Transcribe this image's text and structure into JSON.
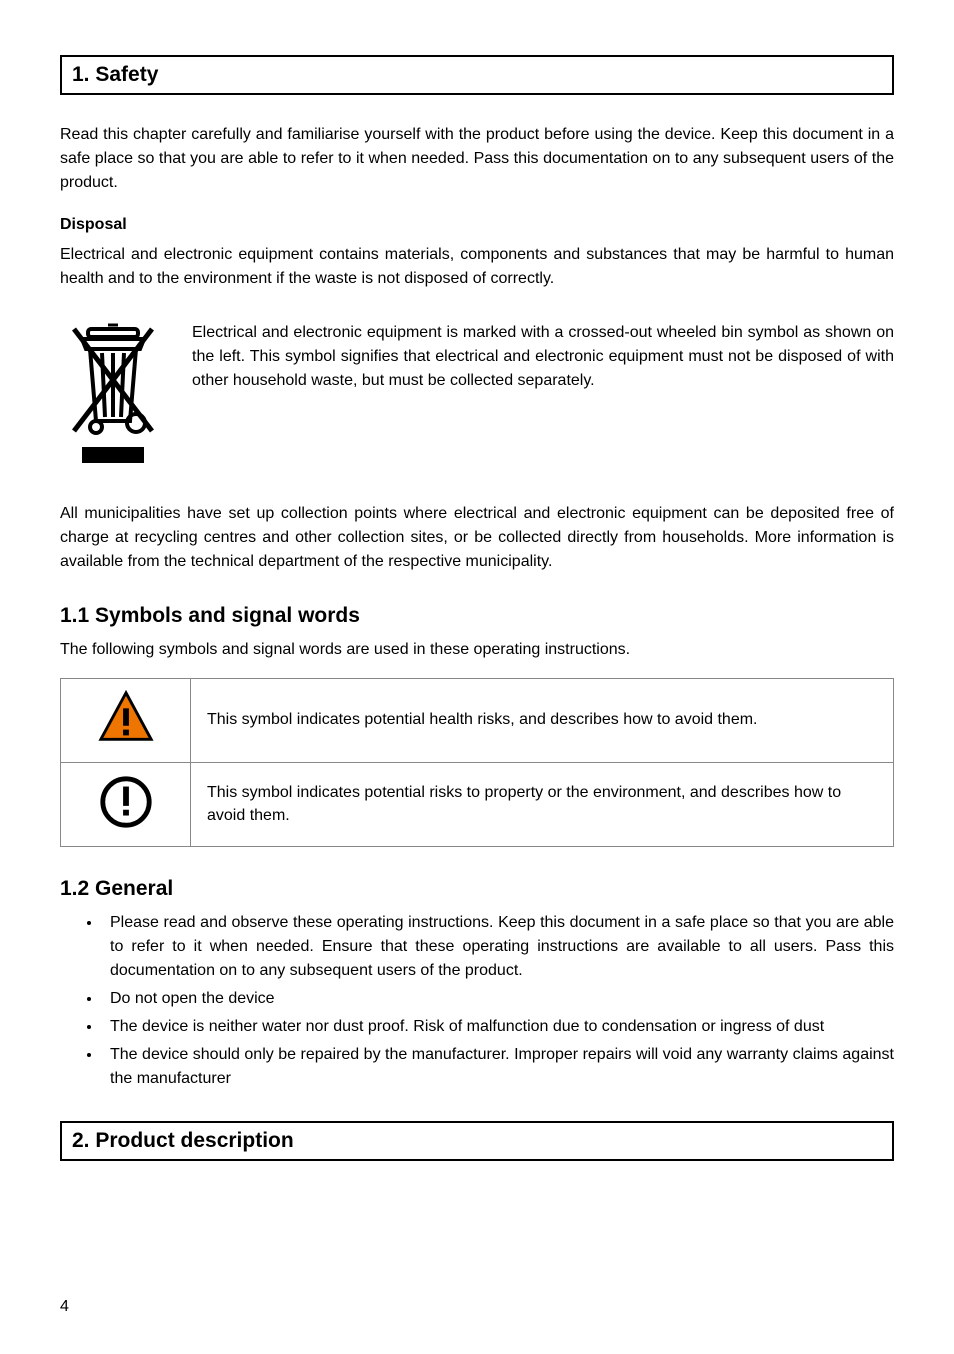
{
  "section1": {
    "title": "1. Safety",
    "intro": "Read this chapter carefully and familiarise yourself with the product before using the device. Keep this document in a safe place so that you are able to refer to it when needed. Pass this documentation on to any subsequent users of the product.",
    "disposal_title": "Disposal",
    "disposal_p1": "Electrical and electronic equipment contains materials, components and substances that may be harmful to human health and to the environment if the waste is not disposed of correctly.",
    "disposal_p2": "Electrical and electronic equipment is marked with a crossed-out wheeled bin symbol as shown on the left. This symbol signifies that electrical and electronic equipment must not be disposed of with other household waste, but must be collected separately.",
    "disposal_p3": "All municipalities have set up collection points where electrical and electronic equipment can be deposited free of charge at recycling centres and other collection sites, or be collected directly from households. More information is available from the technical department of the respective municipality."
  },
  "symbols": {
    "title": "1.1 Symbols and signal words",
    "intro": "The following symbols and signal words are used in these operating instructions.",
    "rows": [
      {
        "icon": "warning",
        "text": "This symbol indicates potential health risks, and describes how to avoid them."
      },
      {
        "icon": "attention",
        "text": "This symbol indicates potential risks to property or the environment, and describes how to avoid them."
      }
    ]
  },
  "general": {
    "title": "1.2 General",
    "items": [
      "Please read and observe these operating instructions. Keep this document in a safe place so that you are able to refer to it when needed. Ensure that these operating instructions are available to all users. Pass this documentation on to any subsequent users of the product.",
      "Do not open the device",
      "The device is neither water nor dust proof. Risk of malfunction due to condensation or ingress of dust",
      "The device should only be repaired by the manufacturer. Improper repairs will void any warranty claims against the manufacturer"
    ]
  },
  "section2": {
    "title": "2. Product description"
  },
  "page_number": "4"
}
